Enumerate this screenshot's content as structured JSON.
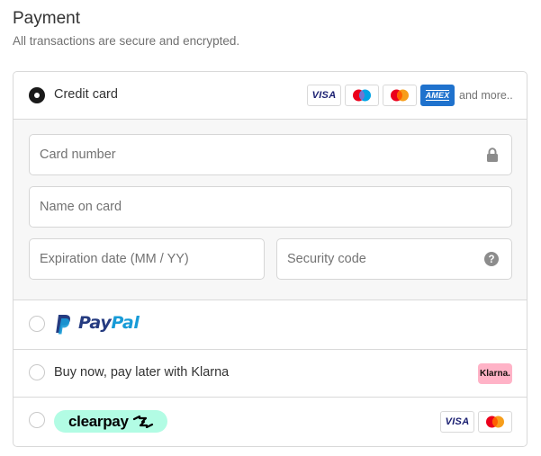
{
  "header": {
    "title": "Payment",
    "subtitle": "All transactions are secure and encrypted."
  },
  "options": {
    "credit_card": {
      "label": "Credit card",
      "selected": true,
      "brands": [
        "VISA",
        "Maestro",
        "Mastercard",
        "AMEX"
      ],
      "more_label": "and more..",
      "fields": {
        "card_number": {
          "placeholder": "Card number",
          "value": ""
        },
        "name_on_card": {
          "placeholder": "Name on card",
          "value": ""
        },
        "expiration": {
          "placeholder": "Expiration date (MM / YY)",
          "value": ""
        },
        "security_code": {
          "placeholder": "Security code",
          "value": ""
        }
      }
    },
    "paypal": {
      "label_pay": "Pay",
      "label_pal": "Pal",
      "selected": false
    },
    "klarna": {
      "label": "Buy now, pay later with Klarna",
      "badge": "Klarna.",
      "selected": false
    },
    "clearpay": {
      "label": "clearpay",
      "selected": false,
      "brands": [
        "VISA",
        "Mastercard"
      ]
    }
  },
  "icons": [
    "radio-checked-icon",
    "lock-icon",
    "help-icon",
    "paypal-logo-icon",
    "clearpay-arrows-icon"
  ],
  "colors": {
    "paypal_dark": "#253b80",
    "paypal_light": "#179bd7",
    "klarna_pink": "#ffb3c7",
    "clearpay_mint": "#b2fce4",
    "amex_blue": "#1f72cd"
  }
}
